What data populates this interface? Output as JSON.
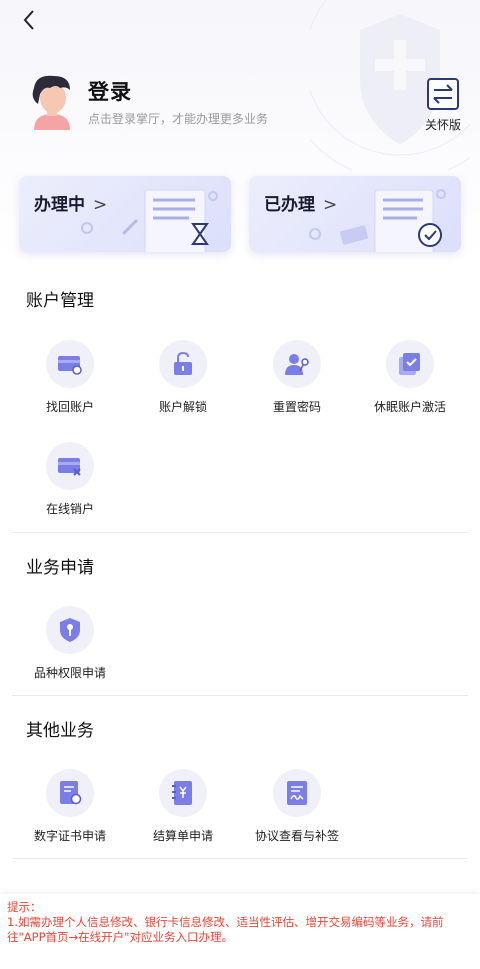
{
  "profile": {
    "title": "登录",
    "subtitle": "点击登录掌厅，才能办理更多业务"
  },
  "care_mode": {
    "label": "关怀版"
  },
  "cards": [
    {
      "title": "办理中",
      "chevron": ">"
    },
    {
      "title": "已办理",
      "chevron": ">"
    }
  ],
  "sections": {
    "account": {
      "title": "账户管理",
      "items": [
        {
          "label": "找回账户",
          "icon": "card-search-icon"
        },
        {
          "label": "账户解锁",
          "icon": "unlock-icon"
        },
        {
          "label": "重置密码",
          "icon": "user-key-icon"
        },
        {
          "label": "休眠账户激活",
          "icon": "check-stack-icon"
        },
        {
          "label": "在线销户",
          "icon": "card-close-icon"
        }
      ]
    },
    "apply": {
      "title": "业务申请",
      "items": [
        {
          "label": "品种权限申请",
          "icon": "shield-key-icon"
        }
      ]
    },
    "other": {
      "title": "其他业务",
      "items": [
        {
          "label": "数字证书申请",
          "icon": "certificate-icon"
        },
        {
          "label": "结算单申请",
          "icon": "statement-icon"
        },
        {
          "label": "协议查看与补签",
          "icon": "agreement-sign-icon"
        }
      ]
    }
  },
  "tip": {
    "title": "提示：",
    "line1": "1.如需办理个人信息修改、银行卡信息修改、适当性评估、增开交易编码等业务，请前",
    "line2": "往\"APP首页→在线开户\"对应业务入口办理。"
  },
  "colors": {
    "accent": "#6e6ee0",
    "tip": "#e0493a",
    "tile_bg": "#f0f0f8"
  }
}
